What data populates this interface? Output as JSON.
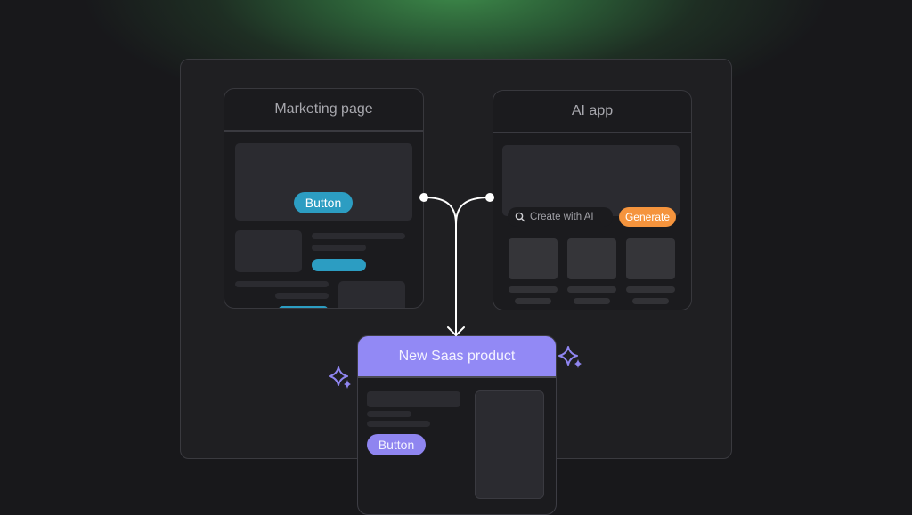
{
  "marketing_card": {
    "title": "Marketing page",
    "hero_button_label": "Button",
    "accent_color": "#2c9dc2"
  },
  "ai_card": {
    "title": "AI app",
    "search_placeholder": "Create with AI",
    "search_icon": "search-icon",
    "generate_label": "Generate",
    "accent_color": "#f5943d"
  },
  "saas_card": {
    "title": "New Saas product",
    "button_label": "Button",
    "accent_color": "#9289f5"
  },
  "decorations": {
    "connector": "merge-arrow",
    "sparkle_icon": "sparkle-icon",
    "sparkle_color": "#8f85f0"
  }
}
